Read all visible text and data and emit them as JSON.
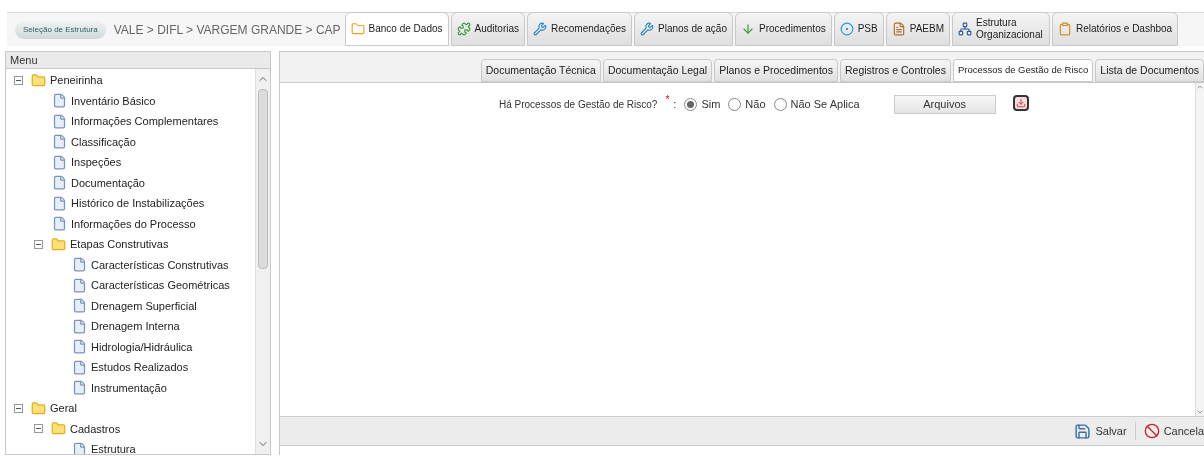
{
  "structure_button": "Seleção de Estrutura",
  "breadcrumb": "VALE > DIFL > VARGEM GRANDE > CAP",
  "modules": [
    {
      "label": "Banco de Dados",
      "kind": "folder",
      "selected": true
    },
    {
      "label": "Auditorias",
      "kind": "puzzle",
      "selected": false
    },
    {
      "label": "Recomendações",
      "kind": "wrench",
      "selected": false
    },
    {
      "label": "Planos de ação",
      "kind": "wrench",
      "selected": false
    },
    {
      "label": "Procedimentos",
      "kind": "arrow",
      "selected": false
    },
    {
      "label": "PSB",
      "kind": "target",
      "selected": false
    },
    {
      "label": "PAEBM",
      "kind": "doc",
      "selected": false
    },
    {
      "label": "Estrutura Organizacional",
      "kind": "org",
      "selected": false
    },
    {
      "label": "Relatórios e Dashboa",
      "kind": "clipboard",
      "selected": false
    }
  ],
  "menu": {
    "title": "Menu",
    "tree": [
      {
        "label": "Peneirinha",
        "kind": "folder",
        "expanded": true,
        "children": [
          {
            "label": "Inventário Básico",
            "kind": "page"
          },
          {
            "label": "Informações Complementares",
            "kind": "page"
          },
          {
            "label": "Classificação",
            "kind": "page"
          },
          {
            "label": "Inspeções",
            "kind": "page"
          },
          {
            "label": "Documentação",
            "kind": "page"
          },
          {
            "label": "Histórico de Instabilizações",
            "kind": "page"
          },
          {
            "label": "Informações do Processo",
            "kind": "page"
          },
          {
            "label": "Etapas Construtivas",
            "kind": "folder",
            "expanded": true,
            "children": [
              {
                "label": "Características Construtivas",
                "kind": "page"
              },
              {
                "label": "Características Geométricas",
                "kind": "page"
              },
              {
                "label": "Drenagem Superficial",
                "kind": "page"
              },
              {
                "label": "Drenagem Interna",
                "kind": "page"
              },
              {
                "label": "Hidrologia/Hidráulica",
                "kind": "page"
              },
              {
                "label": "Estudos Realizados",
                "kind": "page"
              },
              {
                "label": "Instrumentação",
                "kind": "page"
              }
            ]
          }
        ]
      },
      {
        "label": "Geral",
        "kind": "folder",
        "expanded": true,
        "children": [
          {
            "label": "Cadastros",
            "kind": "folder",
            "expanded": true,
            "children": [
              {
                "label": "Estrutura",
                "kind": "page"
              }
            ]
          }
        ]
      }
    ]
  },
  "tabs": [
    {
      "label": "Documentação Técnica",
      "selected": false
    },
    {
      "label": "Documentação Legal",
      "selected": false
    },
    {
      "label": "Planos e Procedimentos",
      "selected": false
    },
    {
      "label": "Registros e Controles",
      "selected": false
    },
    {
      "label": "Processos de Gestão de Risco",
      "selected": true
    },
    {
      "label": "Lista de Documentos",
      "selected": false
    }
  ],
  "question": {
    "label": "Há Processos de Gestão de Risco?",
    "required_marker": "*",
    "separator": ":",
    "options": [
      {
        "label": "Sim",
        "selected": true
      },
      {
        "label": "Não",
        "selected": false
      },
      {
        "label": "Não Se Aplica",
        "selected": false
      }
    ],
    "files_button": "Arquivos"
  },
  "toolbar": [
    {
      "label": "Salvar",
      "kind": "save"
    },
    {
      "label": "Cancela",
      "kind": "cancel"
    }
  ]
}
